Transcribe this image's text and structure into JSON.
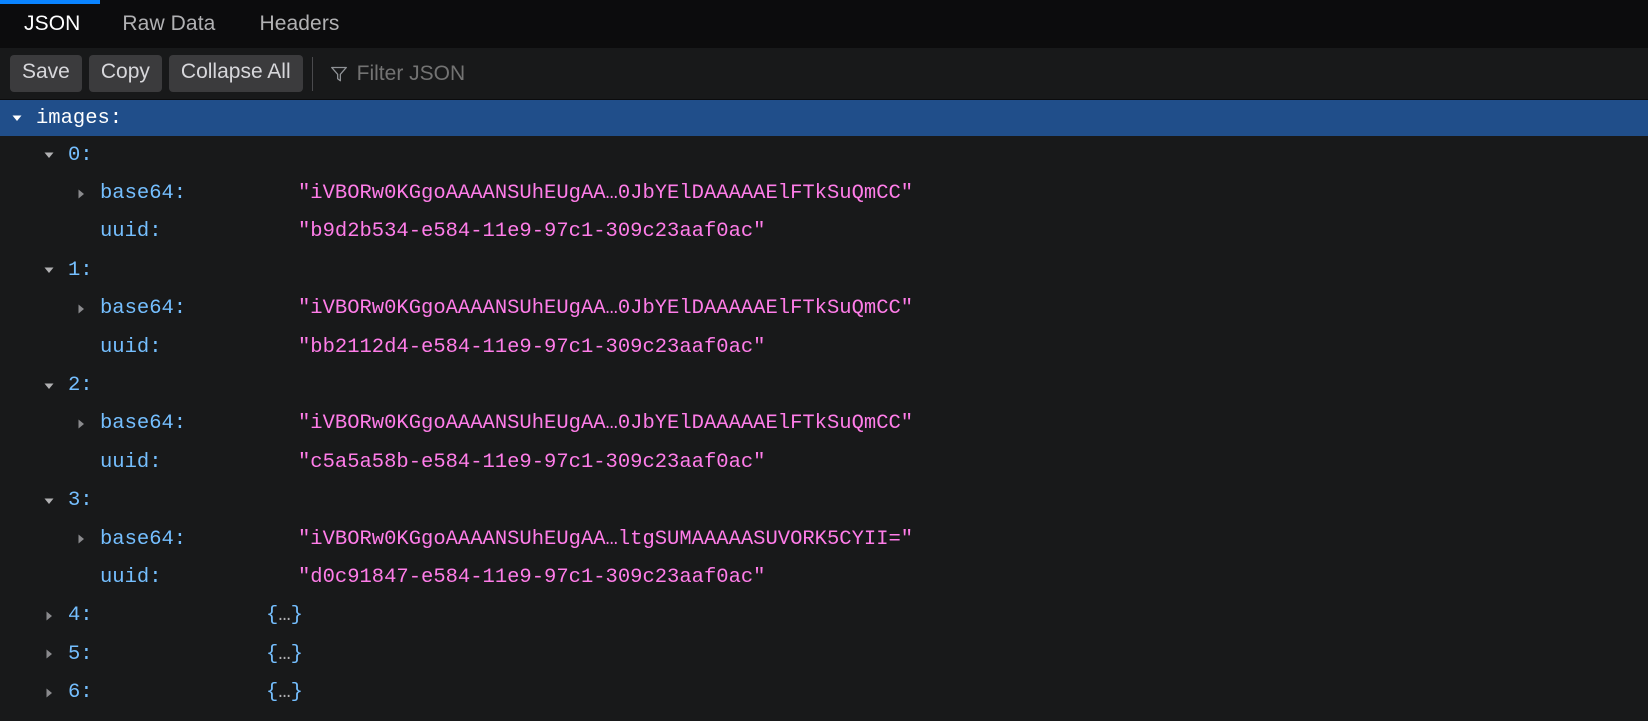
{
  "tabs": [
    {
      "label": "JSON",
      "active": true
    },
    {
      "label": "Raw Data",
      "active": false
    },
    {
      "label": "Headers",
      "active": false
    }
  ],
  "toolbar": {
    "save_label": "Save",
    "copy_label": "Copy",
    "collapse_all_label": "Collapse All",
    "filter_placeholder": "Filter JSON",
    "filter_value": "",
    "filter_icon": "funnel-icon"
  },
  "colors": {
    "accent": "#0a84ff",
    "selected_row": "#204e8a",
    "key": "#75bfff",
    "string_value": "#ff7de9",
    "background": "#18191a",
    "tabbar_background": "#0c0c0d"
  },
  "tree": {
    "root_key": "images:",
    "root_expanded": true,
    "root_selected": true,
    "items": [
      {
        "index": "0:",
        "expanded": true,
        "collapsed_value": "",
        "fields": [
          {
            "key": "base64:",
            "value": "\"iVBORw0KGgoAAAANSUhEUgAA…0JbYElDAAAAAElFTkSuQmCC\"",
            "expandable": true
          },
          {
            "key": "uuid:",
            "value": "\"b9d2b534-e584-11e9-97c1-309c23aaf0ac\"",
            "expandable": false
          }
        ]
      },
      {
        "index": "1:",
        "expanded": true,
        "collapsed_value": "",
        "fields": [
          {
            "key": "base64:",
            "value": "\"iVBORw0KGgoAAAANSUhEUgAA…0JbYElDAAAAAElFTkSuQmCC\"",
            "expandable": true
          },
          {
            "key": "uuid:",
            "value": "\"bb2112d4-e584-11e9-97c1-309c23aaf0ac\"",
            "expandable": false
          }
        ]
      },
      {
        "index": "2:",
        "expanded": true,
        "collapsed_value": "",
        "fields": [
          {
            "key": "base64:",
            "value": "\"iVBORw0KGgoAAAANSUhEUgAA…0JbYElDAAAAAElFTkSuQmCC\"",
            "expandable": true
          },
          {
            "key": "uuid:",
            "value": "\"c5a5a58b-e584-11e9-97c1-309c23aaf0ac\"",
            "expandable": false
          }
        ]
      },
      {
        "index": "3:",
        "expanded": true,
        "collapsed_value": "",
        "fields": [
          {
            "key": "base64:",
            "value": "\"iVBORw0KGgoAAAANSUhEUgAA…ltgSUMAAAAASUVORK5CYII=\"",
            "expandable": true
          },
          {
            "key": "uuid:",
            "value": "\"d0c91847-e584-11e9-97c1-309c23aaf0ac\"",
            "expandable": false
          }
        ]
      },
      {
        "index": "4:",
        "expanded": false,
        "collapsed_value": "{…}",
        "fields": []
      },
      {
        "index": "5:",
        "expanded": false,
        "collapsed_value": "{…}",
        "fields": []
      },
      {
        "index": "6:",
        "expanded": false,
        "collapsed_value": "{…}",
        "fields": []
      }
    ]
  }
}
